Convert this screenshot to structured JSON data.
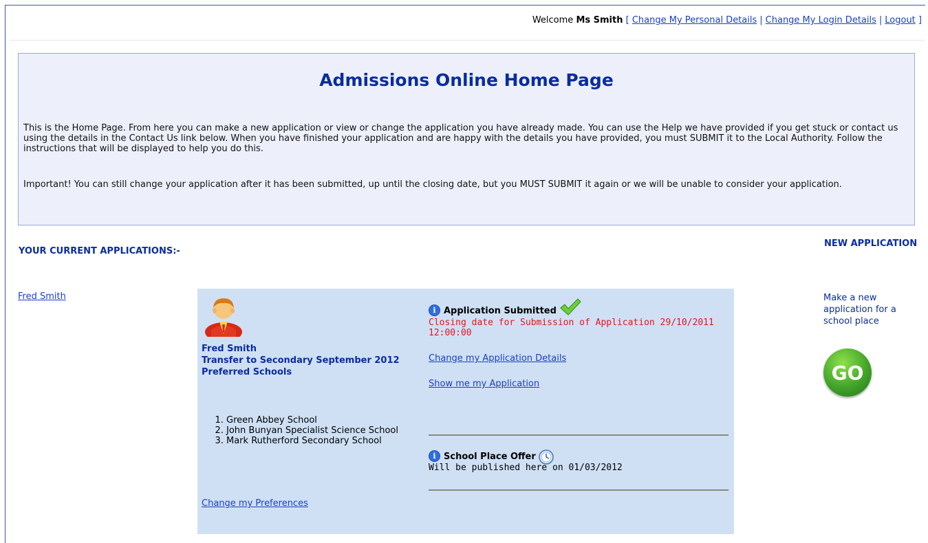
{
  "header": {
    "welcome_prefix": "Welcome",
    "user_name": "Ms Smith",
    "bracket_open": "[",
    "bracket_close": "]",
    "separator": "|",
    "links": {
      "personal_details": "Change My Personal Details",
      "login_details": "Change My Login Details",
      "logout": "Logout"
    }
  },
  "intro": {
    "title": "Admissions Online Home Page",
    "paragraph1": "This is the Home Page. From here you can make a new application or view or change the application you have already made. You can use the Help we have provided if you get stuck or contact us using the details in the Contact Us link below. When you have finished your application and are happy with the details you have provided, you must SUBMIT it to the Local Authority. Follow the instructions that will be displayed to help you do this.",
    "paragraph2": "Important! You can still change your application after it has been submitted, up until the closing date, but you MUST SUBMIT it again or we will be unable to consider your application."
  },
  "applications": {
    "heading": "YOUR CURRENT APPLICATIONS:-",
    "child_link": "Fred Smith",
    "card": {
      "child_name": "Fred Smith",
      "transfer": "Transfer to Secondary September 2012",
      "preferred_label": "Preferred Schools",
      "schools": [
        "Green Abbey School",
        "John Bunyan Specialist Science School",
        "Mark Rutherford Secondary School"
      ],
      "change_prefs_link": "Change my Preferences",
      "status_title": "Application Submitted",
      "closing_text": "Closing date for Submission of Application 29/10/2011 12:00:00",
      "change_details_link": "Change my Application Details",
      "show_application_link": "Show me my Application",
      "offer_title": "School Place Offer",
      "offer_text": "Will be published here on 01/03/2012"
    }
  },
  "new_application": {
    "heading": "NEW APPLICATION",
    "description": "Make a new application for a school place",
    "go_label": "GO"
  },
  "icons": {
    "info": "i",
    "avatar": "person-avatar-icon",
    "check": "checkmark-icon",
    "clock": "clock-icon"
  },
  "colors": {
    "heading_blue": "#0a2c9f",
    "link_blue": "#1a3fbf",
    "closing_red": "#e3141d",
    "card_bg": "#cfe0f5",
    "intro_bg": "#edf0fa",
    "go_green": "#42a52a"
  }
}
